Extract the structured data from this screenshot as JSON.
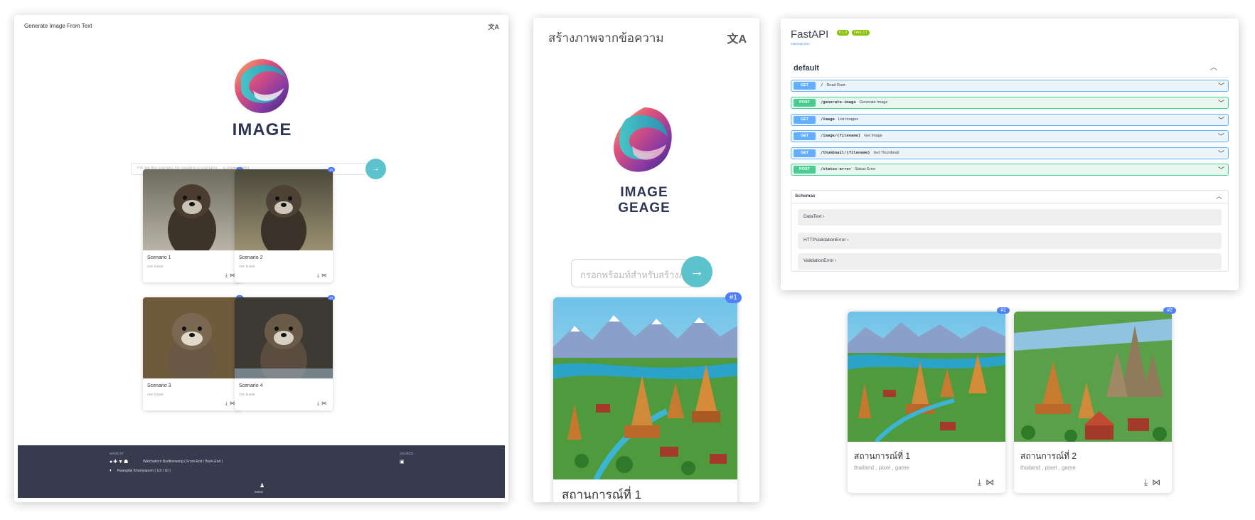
{
  "panel1": {
    "title": "Generate Image From Text",
    "lang_icon": "translate-icon",
    "logo_text": "IMAGE",
    "search_placeholder": "Fill out the prompts for creating a scenario ... a snowy night",
    "cards": [
      {
        "name": "Scenario 1",
        "tags": "one kuwai",
        "badge": "#1"
      },
      {
        "name": "Scenario 2",
        "tags": "one kuwai",
        "badge": "#2"
      },
      {
        "name": "Scenario 3",
        "tags": "one kuwai",
        "badge": "#3"
      },
      {
        "name": "Scenario 4",
        "tags": "one kuwai",
        "badge": "#4"
      }
    ],
    "footer": {
      "made_by": "MADE BY",
      "dev1": "Watchakorn Budtleewong ( Front-End / Back-End )",
      "dev2": "Ruangdej Khamyaporn ( UX / UI )",
      "source": "SOURCE",
      "brand": "IMMU"
    }
  },
  "panel2": {
    "title": "สร้างภาพจากข้อความ",
    "logo_text": "IMAGE GEAGE",
    "search_placeholder": "กรอกพร้อมท์สำหรับสร้างภาพ",
    "card": {
      "name": "สถานการณ์ที่ 1",
      "badge": "#1"
    }
  },
  "fastapi": {
    "title": "FastAPI",
    "version": "0.1.0",
    "oas": "OAS 3.1",
    "link": "/openapi.json",
    "section": "default",
    "operations": [
      {
        "method": "GET",
        "path": "/",
        "summary": "Read Root"
      },
      {
        "method": "POST",
        "path": "/generate-image",
        "summary": "Generate Image"
      },
      {
        "method": "GET",
        "path": "/image",
        "summary": "List Images"
      },
      {
        "method": "GET",
        "path": "/image/{filename}",
        "summary": "Get Image"
      },
      {
        "method": "GET",
        "path": "/thumbnail/{filename}",
        "summary": "Get Thumbnail"
      },
      {
        "method": "POST",
        "path": "/status-error",
        "summary": "Status Error"
      }
    ],
    "schemas_title": "Schemas",
    "schemas": [
      "DataText",
      "HTTPValidationError",
      "ValidationError"
    ]
  },
  "result_cards": [
    {
      "name": "สถานการณ์ที่ 1",
      "tags": "thailand , pixel , game",
      "badge": "#1"
    },
    {
      "name": "สถานการณ์ที่ 2",
      "tags": "thailand , pixel , game",
      "badge": "#2"
    }
  ],
  "colors": {
    "accent": "#5cc3cc",
    "badge": "#4f7ef7",
    "footer": "#363c4e",
    "get": "#61affe",
    "post": "#49cc90"
  }
}
